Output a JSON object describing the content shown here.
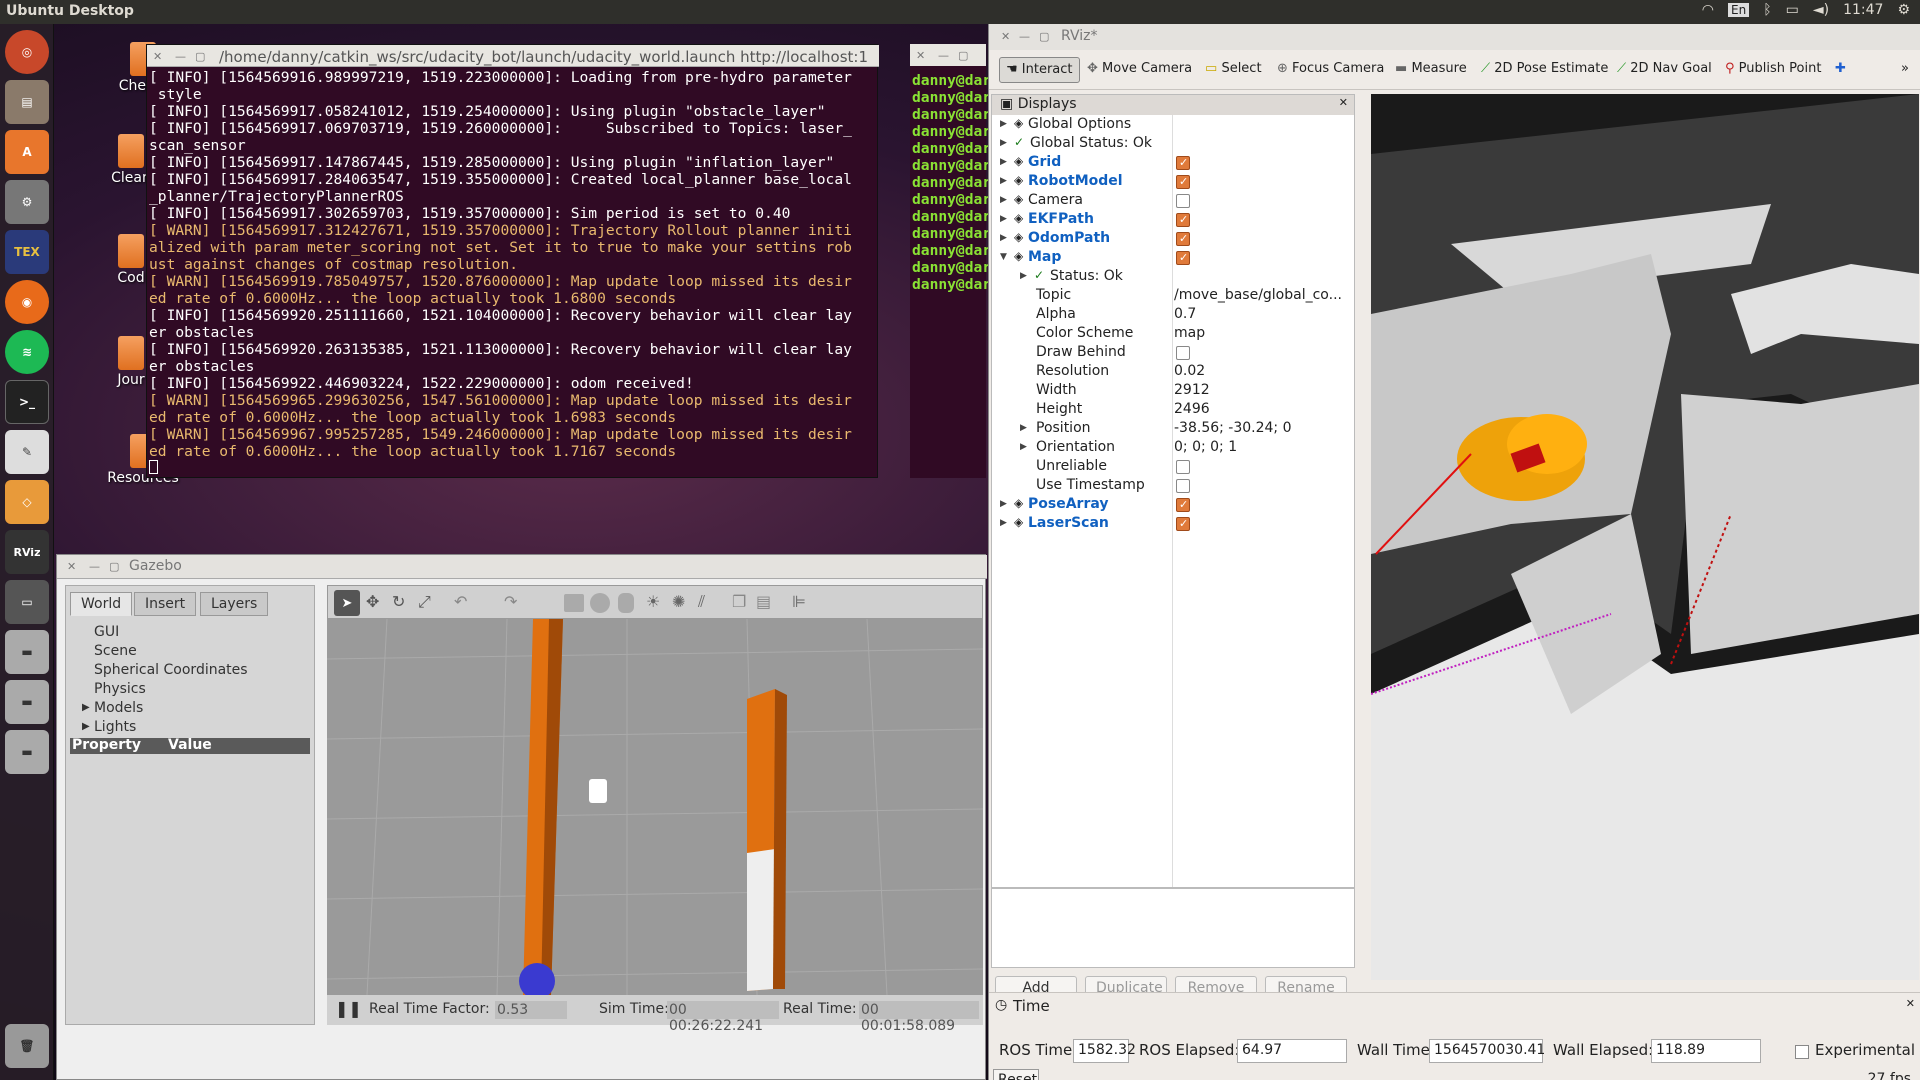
{
  "topbar": {
    "title": "Ubuntu Desktop",
    "lang": "En",
    "time": "11:47"
  },
  "launcher": {
    "tex_label": "TEX",
    "rviz_label": "RViz"
  },
  "desktop_icons": [
    "Cheats",
    "Clean",
    "Cod",
    "Jour",
    "Resources"
  ],
  "terminal": {
    "title": "/home/danny/catkin_ws/src/udacity_bot/launch/udacity_world.launch http://localhost:1",
    "lines": [
      {
        "t": "[ INFO] [1564569916.989997219, 1519.223000000]: Loading from pre-hydro parameter",
        "w": false
      },
      {
        "t": " style",
        "w": false
      },
      {
        "t": "[ INFO] [1564569917.058241012, 1519.254000000]: Using plugin \"obstacle_layer\"",
        "w": false
      },
      {
        "t": "[ INFO] [1564569917.069703719, 1519.260000000]:     Subscribed to Topics: laser_",
        "w": false
      },
      {
        "t": "scan_sensor",
        "w": false
      },
      {
        "t": "[ INFO] [1564569917.147867445, 1519.285000000]: Using plugin \"inflation_layer\"",
        "w": false
      },
      {
        "t": "[ INFO] [1564569917.284063547, 1519.355000000]: Created local_planner base_local",
        "w": false
      },
      {
        "t": "_planner/TrajectoryPlannerROS",
        "w": false
      },
      {
        "t": "[ INFO] [1564569917.302659703, 1519.357000000]: Sim period is set to 0.40",
        "w": false
      },
      {
        "t": "[ WARN] [1564569917.312427671, 1519.357000000]: Trajectory Rollout planner initi",
        "w": true
      },
      {
        "t": "alized with param meter_scoring not set. Set it to true to make your settins rob",
        "w": true
      },
      {
        "t": "ust against changes of costmap resolution.",
        "w": true
      },
      {
        "t": "[ WARN] [1564569919.785049757, 1520.876000000]: Map update loop missed its desir",
        "w": true
      },
      {
        "t": "ed rate of 0.6000Hz... the loop actually took 1.6800 seconds",
        "w": true
      },
      {
        "t": "[ INFO] [1564569920.251111660, 1521.104000000]: Recovery behavior will clear lay",
        "w": false
      },
      {
        "t": "er obstacles",
        "w": false
      },
      {
        "t": "[ INFO] [1564569920.263135385, 1521.113000000]: Recovery behavior will clear lay",
        "w": false
      },
      {
        "t": "er obstacles",
        "w": false
      },
      {
        "t": "[ INFO] [1564569922.446903224, 1522.229000000]: odom received!",
        "w": false
      },
      {
        "t": "[ WARN] [1564569965.299630256, 1547.561000000]: Map update loop missed its desir",
        "w": true
      },
      {
        "t": "ed rate of 0.6000Hz... the loop actually took 1.6983 seconds",
        "w": true
      },
      {
        "t": "[ WARN] [1564569967.995257285, 1549.246000000]: Map update loop missed its desir",
        "w": true
      },
      {
        "t": "ed rate of 0.6000Hz... the loop actually took 1.7167 seconds",
        "w": true
      }
    ]
  },
  "terminal2": {
    "prompt": "danny@dar",
    "count": 13
  },
  "gazebo": {
    "title": "Gazebo",
    "tabs": [
      "World",
      "Insert",
      "Layers"
    ],
    "tree": [
      "GUI",
      "Scene",
      "Spherical Coordinates",
      "Physics",
      "Models",
      "Lights"
    ],
    "prop_header": "Property",
    "value_header": "Value",
    "rtf_label": "Real Time Factor:",
    "rtf": "0.53",
    "sim_label": "Sim Time:",
    "sim": "00 00:26:22.241",
    "real_label": "Real Time:",
    "real": "00 00:01:58.089"
  },
  "rviz": {
    "title": "RViz*",
    "tools": [
      "Interact",
      "Move Camera",
      "Select",
      "Focus Camera",
      "Measure",
      "2D Pose Estimate",
      "2D Nav Goal",
      "Publish Point"
    ],
    "displays_title": "Displays",
    "rows": [
      {
        "k": "Global Options",
        "v": "",
        "cb": null,
        "blue": false,
        "ind": 0,
        "arrow": true
      },
      {
        "k": "Global Status: Ok",
        "v": "",
        "cb": null,
        "blue": false,
        "ind": 0,
        "arrow": true
      },
      {
        "k": "Grid",
        "v": "",
        "cb": true,
        "blue": true,
        "ind": 0,
        "arrow": true
      },
      {
        "k": "RobotModel",
        "v": "",
        "cb": true,
        "blue": true,
        "ind": 0,
        "arrow": true
      },
      {
        "k": "Camera",
        "v": "",
        "cb": false,
        "blue": false,
        "ind": 0,
        "arrow": true
      },
      {
        "k": "EKFPath",
        "v": "",
        "cb": true,
        "blue": true,
        "ind": 0,
        "arrow": true
      },
      {
        "k": "OdomPath",
        "v": "",
        "cb": true,
        "blue": true,
        "ind": 0,
        "arrow": true
      },
      {
        "k": "Map",
        "v": "",
        "cb": true,
        "blue": true,
        "ind": 0,
        "arrow": true
      },
      {
        "k": "Status: Ok",
        "v": "",
        "cb": null,
        "blue": false,
        "ind": 1,
        "arrow": true
      },
      {
        "k": "Topic",
        "v": "/move_base/global_co...",
        "cb": null,
        "blue": false,
        "ind": 1,
        "arrow": false
      },
      {
        "k": "Alpha",
        "v": "0.7",
        "cb": null,
        "blue": false,
        "ind": 1,
        "arrow": false
      },
      {
        "k": "Color Scheme",
        "v": "map",
        "cb": null,
        "blue": false,
        "ind": 1,
        "arrow": false
      },
      {
        "k": "Draw Behind",
        "v": "",
        "cb": false,
        "blue": false,
        "ind": 1,
        "arrow": false
      },
      {
        "k": "Resolution",
        "v": "0.02",
        "cb": null,
        "blue": false,
        "ind": 1,
        "arrow": false
      },
      {
        "k": "Width",
        "v": "2912",
        "cb": null,
        "blue": false,
        "ind": 1,
        "arrow": false
      },
      {
        "k": "Height",
        "v": "2496",
        "cb": null,
        "blue": false,
        "ind": 1,
        "arrow": false
      },
      {
        "k": "Position",
        "v": "-38.56; -30.24; 0",
        "cb": null,
        "blue": false,
        "ind": 1,
        "arrow": true
      },
      {
        "k": "Orientation",
        "v": "0; 0; 0; 1",
        "cb": null,
        "blue": false,
        "ind": 1,
        "arrow": true
      },
      {
        "k": "Unreliable",
        "v": "",
        "cb": false,
        "blue": false,
        "ind": 1,
        "arrow": false
      },
      {
        "k": "Use Timestamp",
        "v": "",
        "cb": false,
        "blue": false,
        "ind": 1,
        "arrow": false
      },
      {
        "k": "PoseArray",
        "v": "",
        "cb": true,
        "blue": true,
        "ind": 0,
        "arrow": true
      },
      {
        "k": "LaserScan",
        "v": "",
        "cb": true,
        "blue": true,
        "ind": 0,
        "arrow": true
      }
    ],
    "buttons": {
      "add": "Add",
      "duplicate": "Duplicate",
      "remove": "Remove",
      "rename": "Rename"
    },
    "time": {
      "title": "Time",
      "ros_time_label": "ROS Time:",
      "ros_time": "1582.32",
      "ros_elapsed_label": "ROS Elapsed:",
      "ros_elapsed": "64.97",
      "wall_time_label": "Wall Time:",
      "wall_time": "1564570030.41",
      "wall_elapsed_label": "Wall Elapsed:",
      "wall_elapsed": "118.89",
      "experimental": "Experimental",
      "reset": "Reset",
      "fps": "27 fps"
    }
  }
}
